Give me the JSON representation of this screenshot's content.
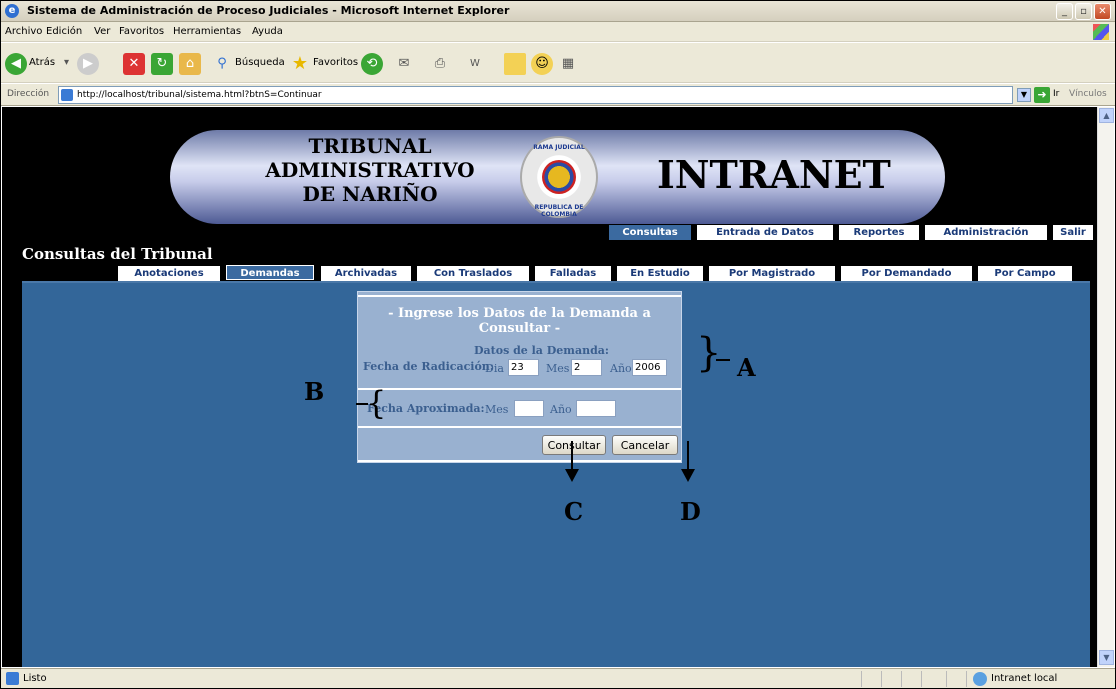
{
  "window": {
    "title": "Sistema de Administración de Proceso Judiciales - Microsoft Internet Explorer",
    "buttons": {
      "minimize": "_",
      "maximize": "▫",
      "close": "✕"
    }
  },
  "menubar": [
    "Archivo",
    "Edición",
    "Ver",
    "Favoritos",
    "Herramientas",
    "Ayuda"
  ],
  "toolbar": {
    "back": "Atrás",
    "search": "Búsqueda",
    "favorites": "Favoritos"
  },
  "address": {
    "label": "Dirección",
    "url": "http://localhost/tribunal/sistema.html?btnS=Continuar",
    "go": "Ir",
    "links": "Vínculos"
  },
  "banner": {
    "line1": "TRIBUNAL",
    "line2": "ADMINISTRATIVO",
    "line3": "DE NARIÑO",
    "seal_top": "RAMA JUDICIAL",
    "seal_bottom": "REPUBLICA DE COLOMBIA",
    "intranet": "INTRANET"
  },
  "topmenu": [
    "Consultas",
    "Entrada de Datos",
    "Reportes",
    "Administración",
    "Salir"
  ],
  "section_title": "Consultas del Tribunal",
  "subtabs": [
    "Anotaciones",
    "Demandas",
    "Archivadas",
    "Con Traslados",
    "Falladas",
    "En Estudio",
    "Por Magistrado",
    "Por Demandado",
    "Por Campo"
  ],
  "form": {
    "header": "- Ingrese los Datos de la Demanda a Consultar -",
    "subheader": "Datos de la Demanda:",
    "fecha_radicacion_label": "Fecha de Radicación:",
    "dia_label": "Dia",
    "dia_value": "23",
    "mes_label": "Mes",
    "mes_value": "2",
    "anio_label": "Año",
    "anio_value": "2006",
    "fecha_aprox_label": "Fecha Aproximada:",
    "aprox_mes_label": "Mes",
    "aprox_mes_value": "",
    "aprox_anio_label": "Año",
    "aprox_anio_value": "",
    "consultar": "Consultar",
    "cancelar": "Cancelar"
  },
  "annotations": {
    "a": "A",
    "b": "B",
    "c": "C",
    "d": "D"
  },
  "status": {
    "text": "Listo",
    "zone": "Intranet local"
  },
  "colors": {
    "panel": "#336699",
    "form": "#99b1d0",
    "tab_active": "#3b6aa0"
  }
}
